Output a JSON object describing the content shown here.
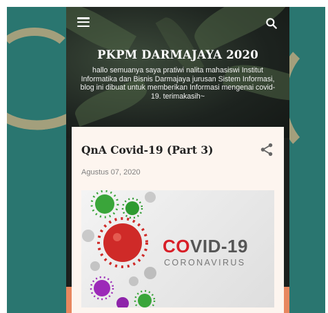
{
  "blog": {
    "title": "PKPM DARMAJAYA 2020",
    "description": "hallo semuanya saya pratiwi nalita mahasiswi Institut Informatika dan Bisnis Darmajaya jurusan Sistem Informasi, blog ini dibuat untuk memberikan Informasi mengenai covid-19. terimakasih~"
  },
  "post": {
    "title": "QnA Covid-19 (Part 3)",
    "date": "Agustus 07, 2020",
    "image": {
      "headline_red": "CO",
      "headline_rest": "VID-19",
      "subtitle": "CORONAVIRUS"
    }
  },
  "icons": {
    "menu": "hamburger-menu-icon",
    "search": "search-icon",
    "share": "share-icon"
  },
  "colors": {
    "background_teal": "#2a7670",
    "card": "#fdf5ef",
    "covid_red": "#d81e27",
    "accent_orange": "#e8875f"
  }
}
